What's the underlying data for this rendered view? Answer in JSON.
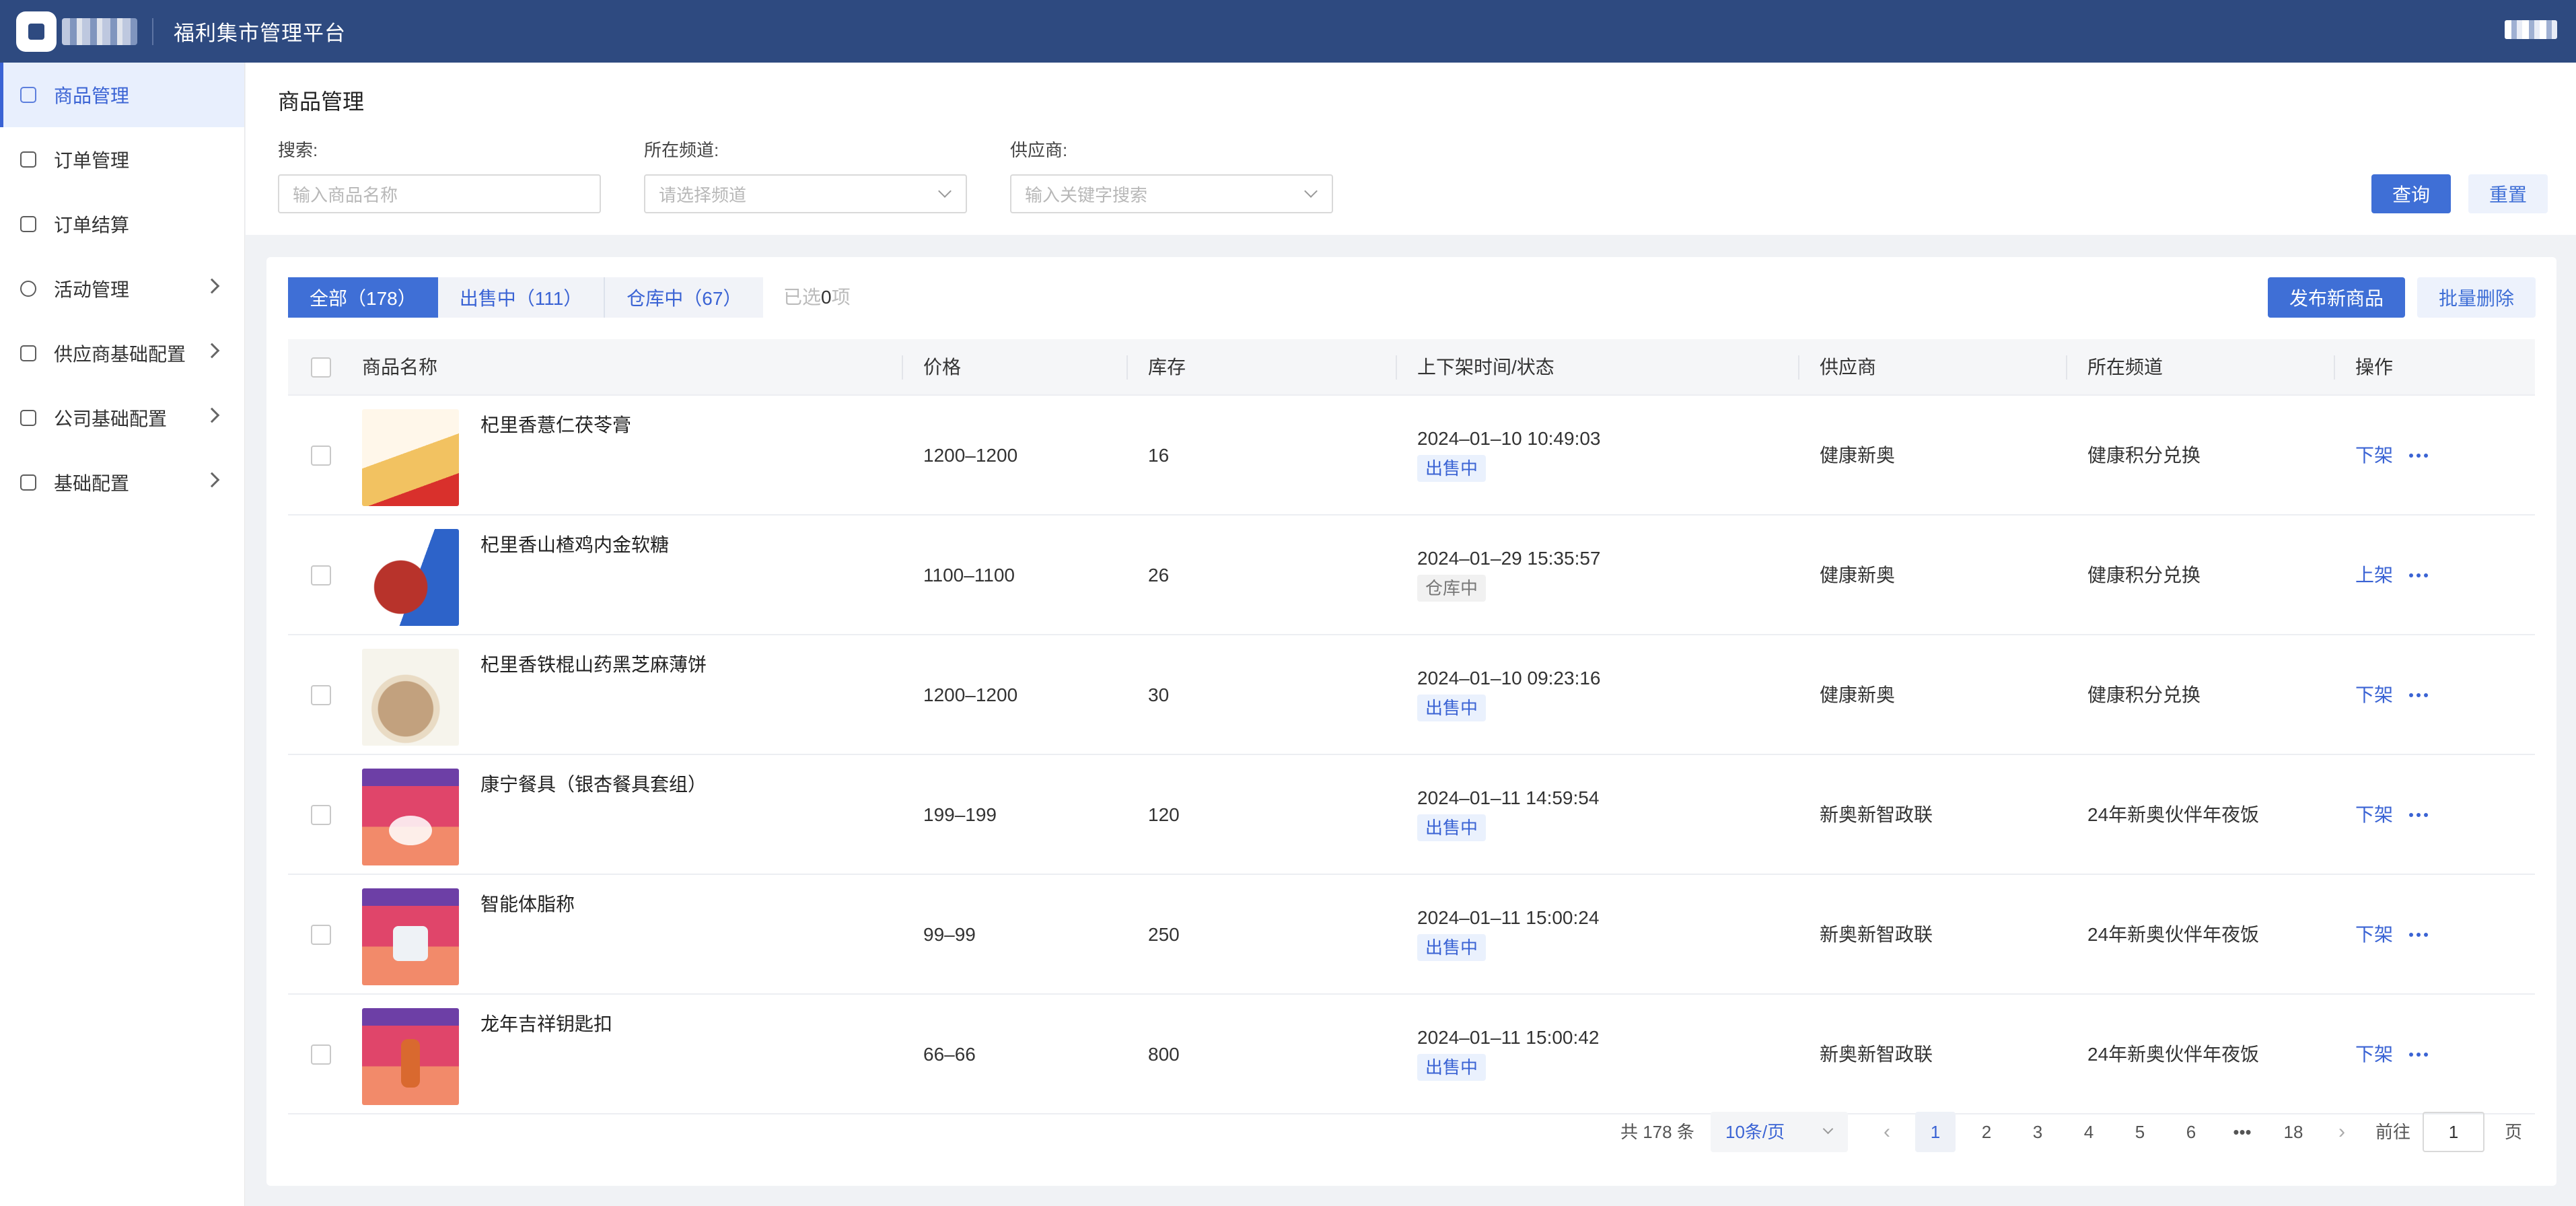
{
  "header": {
    "platform_title": "福利集市管理平台"
  },
  "sidebar": {
    "items": [
      {
        "label": "商品管理",
        "active": true,
        "icon": "goods-icon"
      },
      {
        "label": "订单管理",
        "icon": "clipboard-icon"
      },
      {
        "label": "订单结算",
        "icon": "settlement-icon"
      },
      {
        "label": "活动管理",
        "icon": "activity-icon",
        "expandable": true
      },
      {
        "label": "供应商基础配置",
        "icon": "store-icon",
        "expandable": true
      },
      {
        "label": "公司基础配置",
        "icon": "building-icon",
        "expandable": true
      },
      {
        "label": "基础配置",
        "icon": "gear-icon",
        "expandable": true
      }
    ]
  },
  "filters": {
    "page_title": "商品管理",
    "search_label": "搜索:",
    "search_placeholder": "输入商品名称",
    "channel_label": "所在频道:",
    "channel_placeholder": "请选择频道",
    "supplier_label": "供应商:",
    "supplier_placeholder": "输入关键字搜索",
    "query_button": "查询",
    "reset_button": "重置"
  },
  "toolbar": {
    "tabs": [
      {
        "label": "全部（178）",
        "active": true
      },
      {
        "label": "出售中（111）"
      },
      {
        "label": "仓库中（67）"
      }
    ],
    "selected_prefix": "已选",
    "selected_count": "0",
    "selected_suffix": "项",
    "publish_button": "发布新商品",
    "batch_delete_button": "批量删除"
  },
  "table": {
    "headers": [
      "商品名称",
      "价格",
      "库存",
      "上下架时间/状态",
      "供应商",
      "所在频道",
      "操作"
    ],
    "rows": [
      {
        "name": "杞里香薏仁茯苓膏",
        "price": "1200–1200",
        "stock": "16",
        "time": "2024–01–10 10:49:03",
        "status": "出售中",
        "supplier": "健康新奥",
        "channel": "健康积分兑换",
        "action": "下架",
        "thumb": "tea"
      },
      {
        "name": "杞里香山楂鸡内金软糖",
        "price": "1100–1100",
        "stock": "26",
        "time": "2024–01–29 15:35:57",
        "status": "仓库中",
        "supplier": "健康新奥",
        "channel": "健康积分兑换",
        "action": "上架",
        "thumb": "candy"
      },
      {
        "name": "杞里香铁棍山药黑芝麻薄饼",
        "price": "1200–1200",
        "stock": "30",
        "time": "2024–01–10 09:23:16",
        "status": "出售中",
        "supplier": "健康新奥",
        "channel": "健康积分兑换",
        "action": "下架",
        "thumb": "biscuit"
      },
      {
        "name": "康宁餐具（银杏餐具套组）",
        "price": "199–199",
        "stock": "120",
        "time": "2024–01–11 14:59:54",
        "status": "出售中",
        "supplier": "新奥新智政联",
        "channel": "24年新奥伙伴年夜饭",
        "action": "下架",
        "thumb": "promo"
      },
      {
        "name": "智能体脂称",
        "price": "99–99",
        "stock": "250",
        "time": "2024–01–11 15:00:24",
        "status": "出售中",
        "supplier": "新奥新智政联",
        "channel": "24年新奥伙伴年夜饭",
        "action": "下架",
        "thumb": "promo scale"
      },
      {
        "name": "龙年吉祥钥匙扣",
        "price": "66–66",
        "stock": "800",
        "time": "2024–01–11 15:00:42",
        "status": "出售中",
        "supplier": "新奥新智政联",
        "channel": "24年新奥伙伴年夜饭",
        "action": "下架",
        "thumb": "promo charm"
      }
    ]
  },
  "pagination": {
    "total": "共 178 条",
    "page_size": "10条/页",
    "pages": [
      "1",
      "2",
      "3",
      "4",
      "5",
      "6",
      "•••",
      "18"
    ],
    "current_page": "1",
    "goto_label": "前往",
    "goto_value": "1",
    "goto_suffix": "页"
  },
  "colors": {
    "topbar": "#2e4a80",
    "primary": "#3f6fd6",
    "link": "#3a63d4"
  }
}
